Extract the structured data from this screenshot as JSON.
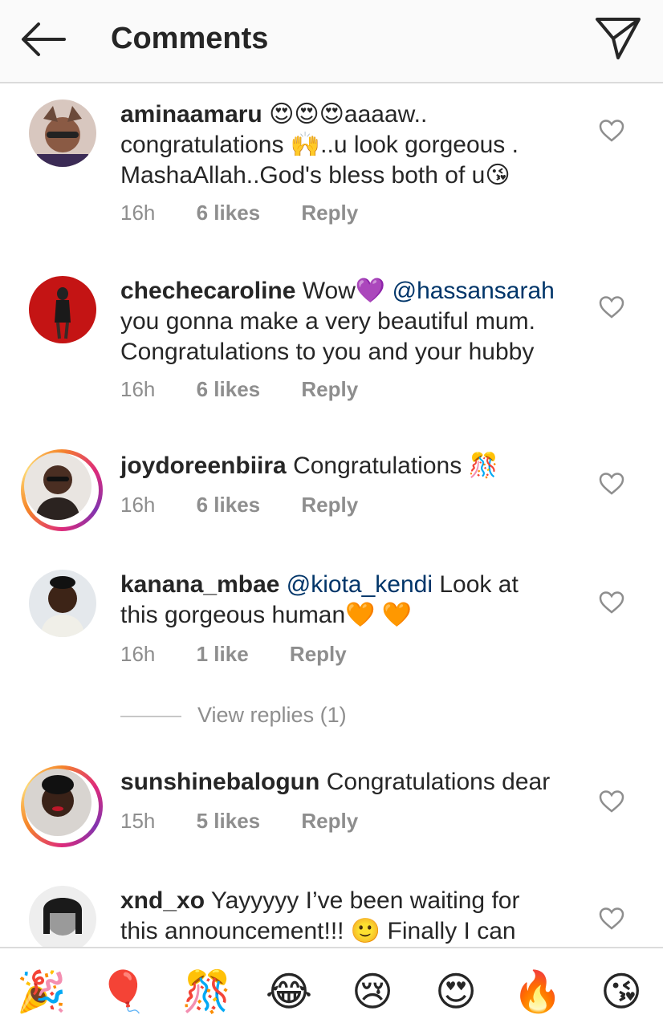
{
  "header": {
    "title": "Comments",
    "back_icon": "arrow-left-icon",
    "send_icon": "paper-plane-icon"
  },
  "comments": [
    {
      "username": "aminaamaru",
      "text_parts": [
        "😍😍😍aaaaw..",
        "congratulations 🙌..u look gorgeous .",
        "MashaAllah..God's bless both of u😘"
      ],
      "time": "16h",
      "likes": "6 likes",
      "reply": "Reply"
    },
    {
      "username": "chechecaroline",
      "text_lead": "Wow💜",
      "mention": "@hassansarah",
      "text_parts": [
        "you gonna make a very beautiful mum.",
        "Congratulations to you and your hubby"
      ],
      "time": "16h",
      "likes": "6 likes",
      "reply": "Reply"
    },
    {
      "username": "joydoreenbiira",
      "text_lead": "Congratulations 🎊",
      "time": "16h",
      "likes": "6 likes",
      "reply": "Reply"
    },
    {
      "username": "kanana_mbae",
      "mention": "@kiota_kendi",
      "text_lead": "Look at",
      "text_parts": [
        "this gorgeous human🧡 🧡"
      ],
      "time": "16h",
      "likes": "1 like",
      "reply": "Reply",
      "view_replies": "View replies (1)"
    },
    {
      "username": "sunshinebalogun",
      "text_lead": "Congratulations dear",
      "time": "15h",
      "likes": "5 likes",
      "reply": "Reply"
    },
    {
      "username": "xnd_xo",
      "text_lead": "Yayyyyy I’ve been waiting for",
      "text_parts": [
        "this announcement!!! 🙂 Finally I can"
      ]
    }
  ],
  "emoji_bar": [
    "🎉",
    "🎈",
    "🎊",
    "😂",
    "😢",
    "😍",
    "🔥",
    "😘"
  ],
  "colors": {
    "mention": "#003569",
    "meta": "#8e8e8e",
    "text": "#262626",
    "header_bg": "#fafafa"
  }
}
